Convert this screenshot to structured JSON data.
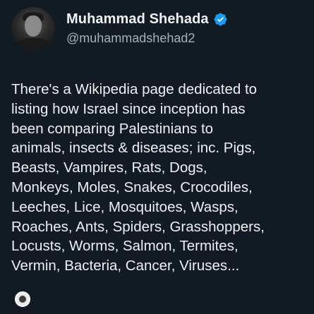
{
  "author": {
    "name": "Muhammad Shehada",
    "handle": "@muhammadshehad2",
    "verified_icon": "verified-badge-icon"
  },
  "post": {
    "lines": [
      "There's a Wikipedia page dedicated to",
      "listing how Israel since inception has",
      "been comparing Palestinians to",
      "animals, insects & diseases; inc. Pigs,",
      "Beasts, Vampires, Rats, Dogs,",
      "Monkeys, Moles, Snakes, Crocodiles,",
      "Leeches, Lice, Mosquitoes, Wasps,",
      "Roaches, Ants, Spiders, Grasshoppers,",
      "Locusts, Worms, Salmon, Termites,",
      "Vermin, Bacteria, Cancer, Viruses..."
    ]
  },
  "colors": {
    "background": "#121a23",
    "verified": "#1d9bf0"
  }
}
